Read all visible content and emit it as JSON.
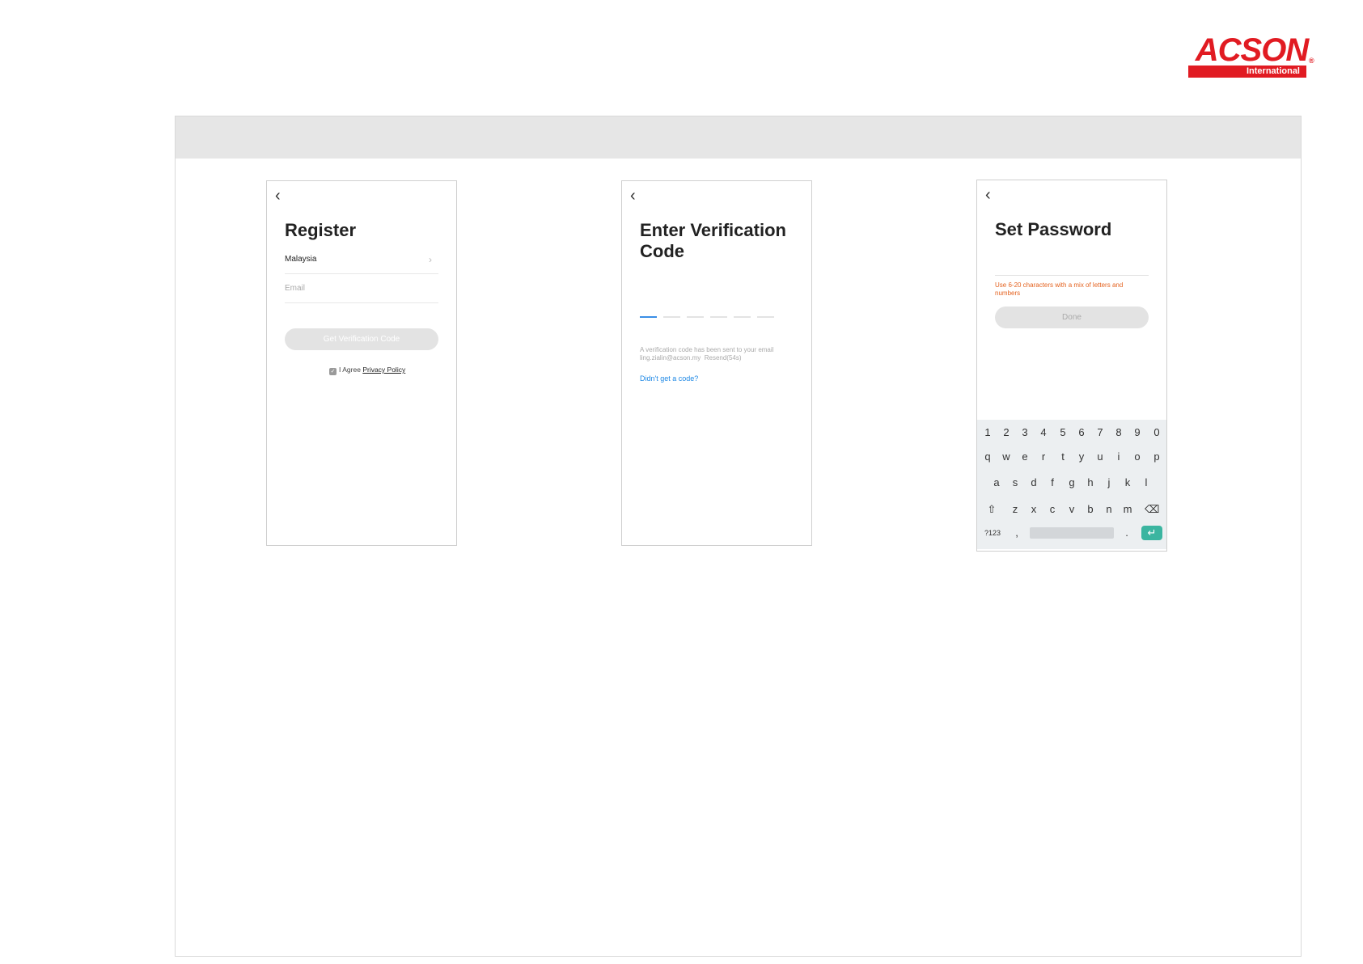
{
  "logo": {
    "word": "ACSON",
    "sub": "International",
    "reg": "®"
  },
  "screens": {
    "register": {
      "back_icon": "chevron-left-icon",
      "title": "Register",
      "country": "Malaysia",
      "email_placeholder": "Email",
      "button": "Get Verification Code",
      "agree_text": "I Agree",
      "privacy_link": "Privacy Policy"
    },
    "verify": {
      "back_icon": "chevron-left-icon",
      "title_line1": "Enter Verification",
      "title_line2": "Code",
      "code_slots": 6,
      "info_line1": "A verification code has been sent to your email",
      "info_line2": "ling.zialin@acson.my",
      "resend": "Resend(54s)",
      "link": "Didn't get a code?"
    },
    "password": {
      "back_icon": "chevron-left-icon",
      "title": "Set Password",
      "hint": "Use 6-20 characters with a mix of letters and numbers",
      "button": "Done",
      "keyboard": {
        "row_numbers": [
          "1",
          "2",
          "3",
          "4",
          "5",
          "6",
          "7",
          "8",
          "9",
          "0"
        ],
        "row1": [
          "q",
          "w",
          "e",
          "r",
          "t",
          "y",
          "u",
          "i",
          "o",
          "p"
        ],
        "row2": [
          "a",
          "s",
          "d",
          "f",
          "g",
          "h",
          "j",
          "k",
          "l"
        ],
        "row3": [
          "⇧",
          "z",
          "x",
          "c",
          "v",
          "b",
          "n",
          "m",
          "⌫"
        ],
        "row4": [
          "?123",
          ",",
          "",
          ".",
          "↵"
        ]
      }
    }
  },
  "colors": {
    "brand_red": "#e11b22",
    "accent_blue": "#1e88e5",
    "hint_orange": "#e4621f",
    "enter_key": "#3bb5a0"
  }
}
